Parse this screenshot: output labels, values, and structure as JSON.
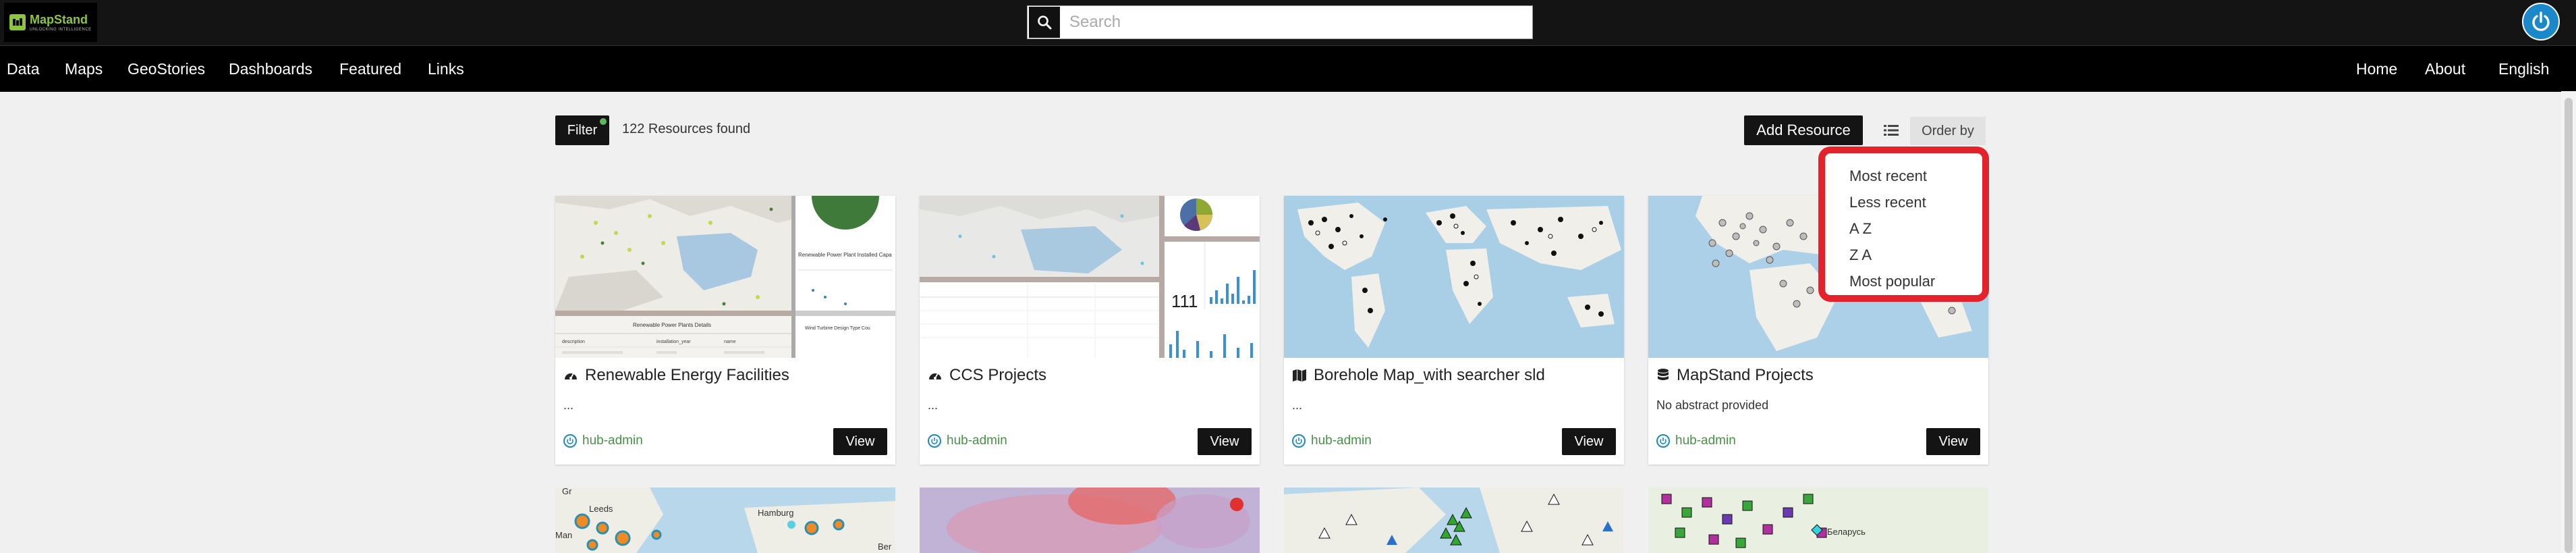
{
  "brand": {
    "name": "MapStand",
    "tagline": "UNLOCKING INTELLIGENCE"
  },
  "search": {
    "placeholder": "Search",
    "value": ""
  },
  "nav": {
    "left": [
      "Data",
      "Maps",
      "GeoStories",
      "Dashboards",
      "Featured",
      "Links"
    ],
    "right": [
      "Home",
      "About",
      "English"
    ]
  },
  "toolbar": {
    "filter_label": "Filter",
    "resources_count": "122 Resources found",
    "add_label": "Add Resource",
    "order_label": "Order by"
  },
  "order_menu": [
    "Most recent",
    "Less recent",
    "A Z",
    "Z A",
    "Most popular"
  ],
  "cards": [
    {
      "title": "Renewable Energy Facilities",
      "abstract": "...",
      "owner": "hub-admin",
      "view": "View",
      "type_icon": "dashboard-icon"
    },
    {
      "title": "CCS Projects",
      "abstract": "...",
      "owner": "hub-admin",
      "view": "View",
      "type_icon": "dashboard-icon"
    },
    {
      "title": "Borehole Map_with searcher sld",
      "abstract": "...",
      "owner": "hub-admin",
      "view": "View",
      "type_icon": "map-icon"
    },
    {
      "title": "MapStand Projects",
      "abstract": "No abstract provided",
      "owner": "hub-admin",
      "view": "View",
      "type_icon": "layer-icon"
    }
  ],
  "thumb_texts": {
    "dash1_panel": "Renewable Power Plant Installed Capa",
    "dash1_table": "Renewable Power Plants Details",
    "dash1_turbine": "Wind Turbine Design Type Cou",
    "dash1_col1": "description",
    "dash1_col2": "installation_year",
    "dash1_col3": "name",
    "dash2_kpi": "111",
    "map_hamburg": "Hamburg",
    "map_leeds": "Leeds",
    "map_gr": "Gr",
    "map_manchester": "Man",
    "map_ber": "Ber",
    "map_belarus": "Беларусь"
  },
  "colors": {
    "topbar": "#141414",
    "navbar": "#000000",
    "accent_red": "#e4222b",
    "brand_green": "#8cc63f",
    "owner_green": "#4a8f4a",
    "user_blue": "#1a88c9"
  }
}
